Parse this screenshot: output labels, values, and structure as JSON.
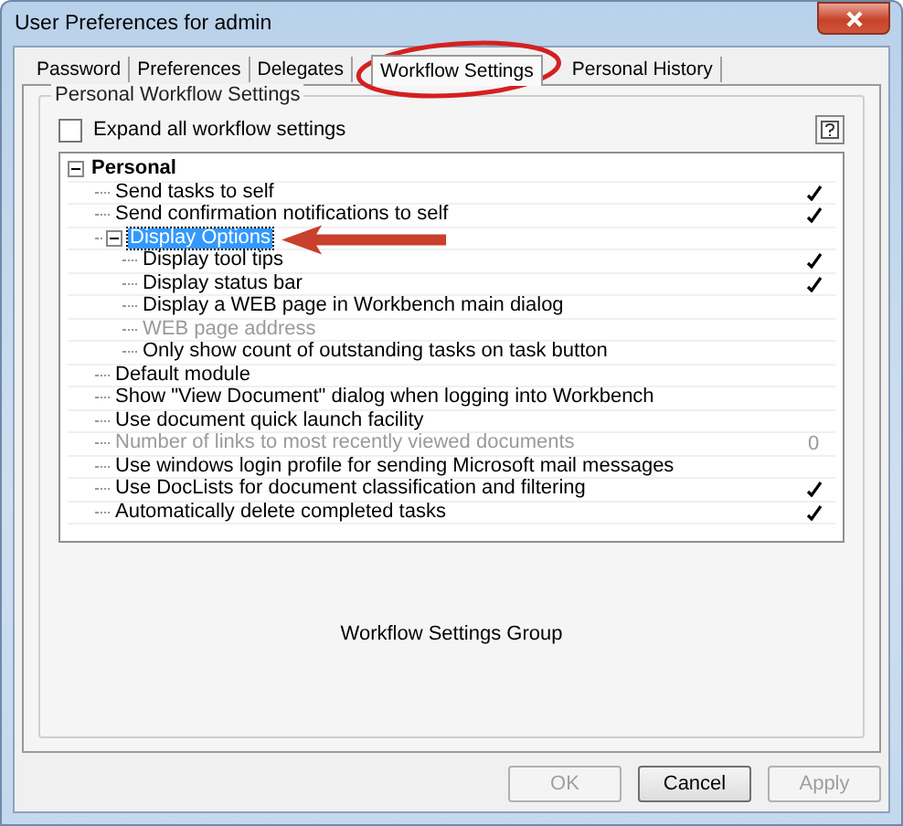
{
  "window": {
    "title": "User Preferences for admin"
  },
  "tabs": [
    {
      "label": "Password",
      "selected": false
    },
    {
      "label": "Preferences",
      "selected": false
    },
    {
      "label": "Delegates",
      "selected": false
    },
    {
      "label": "Workflow Settings",
      "selected": true
    },
    {
      "label": "Personal History",
      "selected": false
    }
  ],
  "group": {
    "title": "Personal Workflow Settings"
  },
  "expand_all": {
    "label": "Expand all workflow settings",
    "checked": false
  },
  "tree": {
    "label": "Personal",
    "kind": "group",
    "expanded": true,
    "selected": false,
    "children": [
      {
        "label": "Send tasks to self",
        "kind": "check",
        "checked": true,
        "disabled": false
      },
      {
        "label": "Send confirmation notifications to self",
        "kind": "check",
        "checked": true,
        "disabled": false
      },
      {
        "label": "Display Options",
        "kind": "group",
        "expanded": true,
        "selected": true,
        "children": [
          {
            "label": "Display tool tips",
            "kind": "check",
            "checked": true,
            "disabled": false
          },
          {
            "label": "Display status bar",
            "kind": "check",
            "checked": true,
            "disabled": false
          },
          {
            "label": "Display a WEB page in Workbench main dialog",
            "kind": "check",
            "checked": false,
            "disabled": false
          },
          {
            "label": "WEB page address",
            "kind": "text",
            "disabled": true
          },
          {
            "label": "Only show count of outstanding tasks on task button",
            "kind": "check",
            "checked": false,
            "disabled": false
          }
        ]
      },
      {
        "label": "Default module",
        "kind": "text",
        "disabled": false
      },
      {
        "label": "Show \"View Document\" dialog when logging into Workbench",
        "kind": "check",
        "checked": false,
        "disabled": false
      },
      {
        "label": "Use document quick launch facility",
        "kind": "check",
        "checked": false,
        "disabled": false
      },
      {
        "label": "Number of links to most recently viewed documents",
        "kind": "number",
        "value": "0",
        "disabled": true
      },
      {
        "label": "Use windows login profile for sending Microsoft mail messages",
        "kind": "check",
        "checked": false,
        "disabled": false
      },
      {
        "label": "Use DocLists for document classification and filtering",
        "kind": "check",
        "checked": true,
        "disabled": false
      },
      {
        "label": "Automatically delete completed tasks",
        "kind": "check",
        "checked": true,
        "disabled": false
      }
    ]
  },
  "group_caption": "Workflow Settings Group",
  "buttons": [
    {
      "label": "OK",
      "disabled": true
    },
    {
      "label": "Cancel",
      "disabled": false
    },
    {
      "label": "Apply",
      "disabled": true
    }
  ]
}
